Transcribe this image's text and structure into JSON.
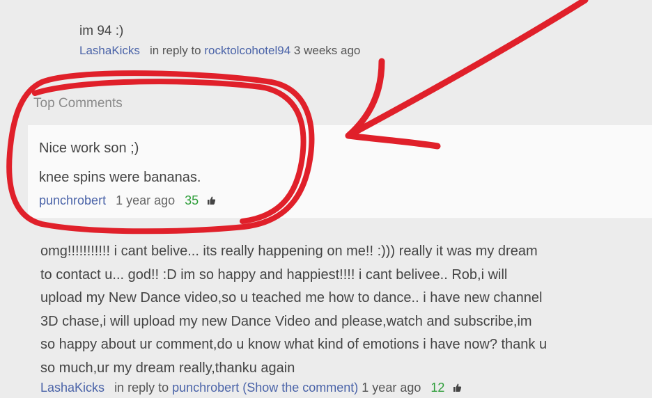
{
  "reply1": {
    "text": "im 94 :)",
    "author": "LashaKicks",
    "reply_prefix": "in reply to",
    "reply_to": "rocktolcohotel94",
    "time": "3 weeks ago"
  },
  "top_comments": {
    "heading": "Top Comments",
    "comment": {
      "line1": "Nice work son ;)",
      "line2": "knee spins were bananas.",
      "author": "punchrobert",
      "time": "1 year ago",
      "likes": "35",
      "like_icon": "thumbs-up-icon"
    }
  },
  "reply2": {
    "lines": [
      "omg!!!!!!!!!!! i cant belive... its really happening on me!! :))) really it was my dream",
      "to contact u... god!! :D im so happy and happiest!!!! i cant belivee.. Rob,i will",
      "upload my New Dance video,so u teached me how to dance.. i have new channel",
      "3D chase,i will upload my new Dance Video and please,watch and subscribe,im",
      "so happy about ur comment,do u know what kind of emotions i have now? thank u",
      "so much,ur my dream really,thanku again"
    ],
    "author": "LashaKicks",
    "reply_prefix": "in reply to",
    "reply_to": "punchrobert",
    "show_comment": "(Show the comment)",
    "time": "1 year ago",
    "likes": "12",
    "like_icon": "thumbs-up-icon"
  },
  "colors": {
    "annotation": "#e0202a",
    "link": "#4a63a8",
    "likes": "#2e9e3a"
  }
}
